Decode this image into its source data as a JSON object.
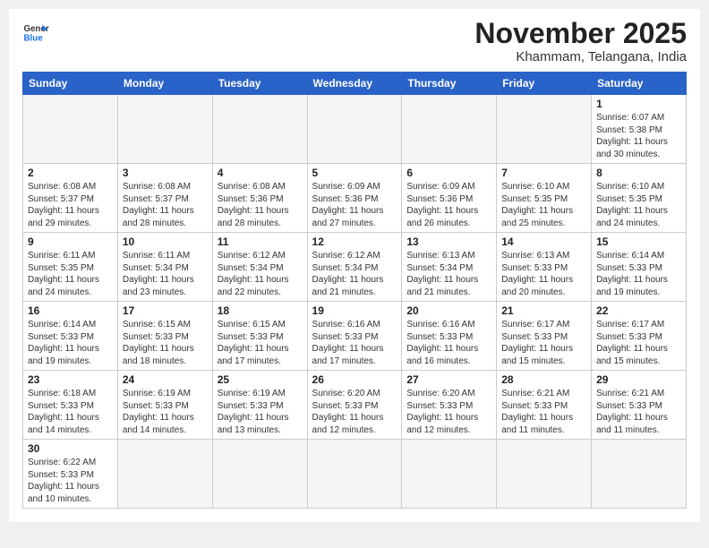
{
  "header": {
    "logo_general": "General",
    "logo_blue": "Blue",
    "month_title": "November 2025",
    "location": "Khammam, Telangana, India"
  },
  "weekdays": [
    "Sunday",
    "Monday",
    "Tuesday",
    "Wednesday",
    "Thursday",
    "Friday",
    "Saturday"
  ],
  "days": [
    {
      "num": "",
      "info": ""
    },
    {
      "num": "",
      "info": ""
    },
    {
      "num": "",
      "info": ""
    },
    {
      "num": "",
      "info": ""
    },
    {
      "num": "",
      "info": ""
    },
    {
      "num": "",
      "info": ""
    },
    {
      "num": "1",
      "info": "Sunrise: 6:07 AM\nSunset: 5:38 PM\nDaylight: 11 hours\nand 30 minutes."
    },
    {
      "num": "2",
      "info": "Sunrise: 6:08 AM\nSunset: 5:37 PM\nDaylight: 11 hours\nand 29 minutes."
    },
    {
      "num": "3",
      "info": "Sunrise: 6:08 AM\nSunset: 5:37 PM\nDaylight: 11 hours\nand 28 minutes."
    },
    {
      "num": "4",
      "info": "Sunrise: 6:08 AM\nSunset: 5:36 PM\nDaylight: 11 hours\nand 28 minutes."
    },
    {
      "num": "5",
      "info": "Sunrise: 6:09 AM\nSunset: 5:36 PM\nDaylight: 11 hours\nand 27 minutes."
    },
    {
      "num": "6",
      "info": "Sunrise: 6:09 AM\nSunset: 5:36 PM\nDaylight: 11 hours\nand 26 minutes."
    },
    {
      "num": "7",
      "info": "Sunrise: 6:10 AM\nSunset: 5:35 PM\nDaylight: 11 hours\nand 25 minutes."
    },
    {
      "num": "8",
      "info": "Sunrise: 6:10 AM\nSunset: 5:35 PM\nDaylight: 11 hours\nand 24 minutes."
    },
    {
      "num": "9",
      "info": "Sunrise: 6:11 AM\nSunset: 5:35 PM\nDaylight: 11 hours\nand 24 minutes."
    },
    {
      "num": "10",
      "info": "Sunrise: 6:11 AM\nSunset: 5:34 PM\nDaylight: 11 hours\nand 23 minutes."
    },
    {
      "num": "11",
      "info": "Sunrise: 6:12 AM\nSunset: 5:34 PM\nDaylight: 11 hours\nand 22 minutes."
    },
    {
      "num": "12",
      "info": "Sunrise: 6:12 AM\nSunset: 5:34 PM\nDaylight: 11 hours\nand 21 minutes."
    },
    {
      "num": "13",
      "info": "Sunrise: 6:13 AM\nSunset: 5:34 PM\nDaylight: 11 hours\nand 21 minutes."
    },
    {
      "num": "14",
      "info": "Sunrise: 6:13 AM\nSunset: 5:33 PM\nDaylight: 11 hours\nand 20 minutes."
    },
    {
      "num": "15",
      "info": "Sunrise: 6:14 AM\nSunset: 5:33 PM\nDaylight: 11 hours\nand 19 minutes."
    },
    {
      "num": "16",
      "info": "Sunrise: 6:14 AM\nSunset: 5:33 PM\nDaylight: 11 hours\nand 19 minutes."
    },
    {
      "num": "17",
      "info": "Sunrise: 6:15 AM\nSunset: 5:33 PM\nDaylight: 11 hours\nand 18 minutes."
    },
    {
      "num": "18",
      "info": "Sunrise: 6:15 AM\nSunset: 5:33 PM\nDaylight: 11 hours\nand 17 minutes."
    },
    {
      "num": "19",
      "info": "Sunrise: 6:16 AM\nSunset: 5:33 PM\nDaylight: 11 hours\nand 17 minutes."
    },
    {
      "num": "20",
      "info": "Sunrise: 6:16 AM\nSunset: 5:33 PM\nDaylight: 11 hours\nand 16 minutes."
    },
    {
      "num": "21",
      "info": "Sunrise: 6:17 AM\nSunset: 5:33 PM\nDaylight: 11 hours\nand 15 minutes."
    },
    {
      "num": "22",
      "info": "Sunrise: 6:17 AM\nSunset: 5:33 PM\nDaylight: 11 hours\nand 15 minutes."
    },
    {
      "num": "23",
      "info": "Sunrise: 6:18 AM\nSunset: 5:33 PM\nDaylight: 11 hours\nand 14 minutes."
    },
    {
      "num": "24",
      "info": "Sunrise: 6:19 AM\nSunset: 5:33 PM\nDaylight: 11 hours\nand 14 minutes."
    },
    {
      "num": "25",
      "info": "Sunrise: 6:19 AM\nSunset: 5:33 PM\nDaylight: 11 hours\nand 13 minutes."
    },
    {
      "num": "26",
      "info": "Sunrise: 6:20 AM\nSunset: 5:33 PM\nDaylight: 11 hours\nand 12 minutes."
    },
    {
      "num": "27",
      "info": "Sunrise: 6:20 AM\nSunset: 5:33 PM\nDaylight: 11 hours\nand 12 minutes."
    },
    {
      "num": "28",
      "info": "Sunrise: 6:21 AM\nSunset: 5:33 PM\nDaylight: 11 hours\nand 11 minutes."
    },
    {
      "num": "29",
      "info": "Sunrise: 6:21 AM\nSunset: 5:33 PM\nDaylight: 11 hours\nand 11 minutes."
    },
    {
      "num": "30",
      "info": "Sunrise: 6:22 AM\nSunset: 5:33 PM\nDaylight: 11 hours\nand 10 minutes."
    },
    {
      "num": "",
      "info": ""
    },
    {
      "num": "",
      "info": ""
    },
    {
      "num": "",
      "info": ""
    },
    {
      "num": "",
      "info": ""
    },
    {
      "num": "",
      "info": ""
    },
    {
      "num": "",
      "info": ""
    }
  ]
}
